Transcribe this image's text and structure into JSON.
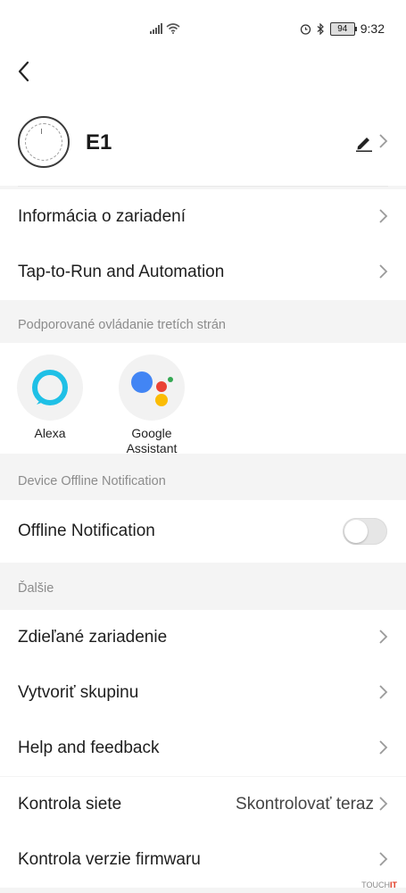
{
  "status_bar": {
    "time": "9:32",
    "battery": "94",
    "icons": [
      "signal-icon",
      "wifi-icon",
      "alarm-icon",
      "bluetooth-icon",
      "battery-icon"
    ]
  },
  "device": {
    "name": "E1"
  },
  "menu_top": [
    {
      "label": "Informácia o zariadení"
    },
    {
      "label": "Tap-to-Run and Automation"
    }
  ],
  "third_party": {
    "section_title": "Podporované ovládanie tretích strán",
    "items": [
      {
        "label": "Alexa"
      },
      {
        "label_line1": "Google",
        "label_line2": "Assistant"
      }
    ]
  },
  "offline": {
    "section_title": "Device Offline Notification",
    "label": "Offline Notification",
    "enabled": false
  },
  "more": {
    "section_title": "Ďalšie",
    "items": [
      {
        "label": "Zdieľané zariadenie"
      },
      {
        "label": "Vytvoriť skupinu"
      },
      {
        "label": "Help and feedback"
      },
      {
        "label": "Kontrola siete",
        "value": "Skontrolovať teraz"
      },
      {
        "label": "Kontrola verzie firmwaru"
      }
    ]
  },
  "watermark": {
    "prefix": "TOUCH",
    "suffix": "IT"
  },
  "colors": {
    "background": "#f4f4f4",
    "surface": "#ffffff",
    "alexa": "#1fc0e6",
    "google_blue": "#4285f4",
    "google_red": "#ea4335",
    "google_yellow": "#fbbc04",
    "google_green": "#34a853"
  }
}
